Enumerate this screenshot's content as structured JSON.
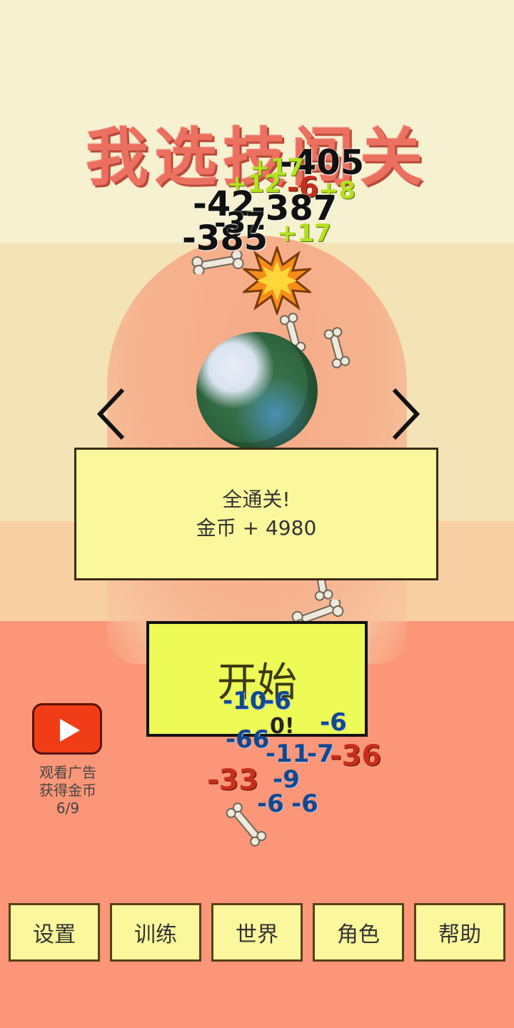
{
  "title": "我选技闯关",
  "damage_numbers": {
    "top": [
      {
        "text": "-405",
        "color": "black"
      },
      {
        "text": "+17",
        "color": "green"
      },
      {
        "text": "+12",
        "color": "green"
      },
      {
        "text": "-6",
        "color": "red"
      },
      {
        "text": "+8",
        "color": "green"
      },
      {
        "text": "-42",
        "color": "black"
      },
      {
        "text": "-387",
        "color": "black"
      },
      {
        "text": "-385",
        "color": "black"
      },
      {
        "text": "+17",
        "color": "green"
      },
      {
        "text": "-37",
        "color": "black"
      }
    ],
    "bottom": [
      {
        "text": "-10",
        "color": "blue"
      },
      {
        "text": "-6",
        "color": "blue"
      },
      {
        "text": "0!",
        "color": "gray"
      },
      {
        "text": "-6",
        "color": "blue"
      },
      {
        "text": "-66",
        "color": "blue"
      },
      {
        "text": "-11",
        "color": "blue"
      },
      {
        "text": "-7",
        "color": "blue"
      },
      {
        "text": "-36",
        "color": "red"
      },
      {
        "text": "-33",
        "color": "red"
      },
      {
        "text": "-9",
        "color": "blue"
      },
      {
        "text": "-6",
        "color": "blue"
      },
      {
        "text": "-6",
        "color": "blue"
      }
    ]
  },
  "info": {
    "line1": "全通关!",
    "line2": "金币 + 4980"
  },
  "start_label": "开始",
  "ad": {
    "line1": "观看广告",
    "line2": "获得金币",
    "count": "6/9"
  },
  "nav": [
    "设置",
    "训练",
    "世界",
    "角色",
    "帮助"
  ],
  "colors": {
    "title": "#ec705f",
    "info_bg": "#fbf79c",
    "start_bg": "#eefa55",
    "ad_red": "#f03d17"
  }
}
